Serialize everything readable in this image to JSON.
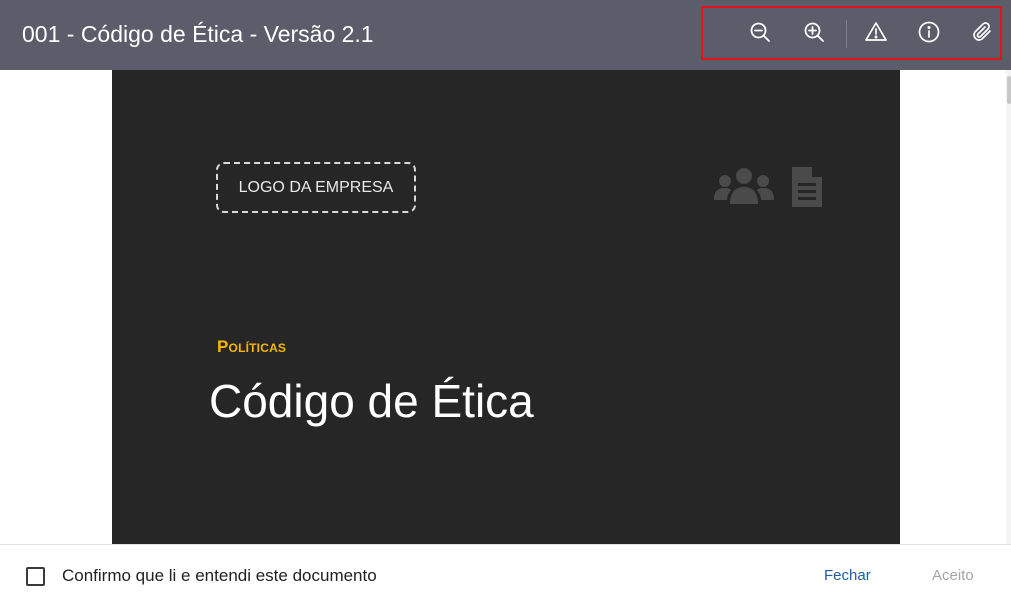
{
  "header": {
    "title": "001 - Código de Ética - Versão 2.1",
    "toolbar": {
      "zoom_out_icon": "zoom-out-icon",
      "zoom_in_icon": "zoom-in-icon",
      "warning_icon": "warning-icon",
      "info_icon": "info-icon",
      "attachment_icon": "paperclip-icon",
      "highlight_color": "#e4121b"
    },
    "background": "#5b5d6b"
  },
  "document": {
    "logo_placeholder": "LOGO DA EMPRESA",
    "category": "Políticas",
    "title": "Código de Ética",
    "icons": [
      "people-icon",
      "file-icon"
    ],
    "page_background": "#262626",
    "category_color": "#f5b800"
  },
  "footer": {
    "confirm_label": "Confirmo que li e entendi este documento",
    "checkbox_checked": false,
    "close_label": "Fechar",
    "accept_label": "Aceito",
    "close_color": "#1d5ea8",
    "accept_color": "#a5a5a5"
  }
}
